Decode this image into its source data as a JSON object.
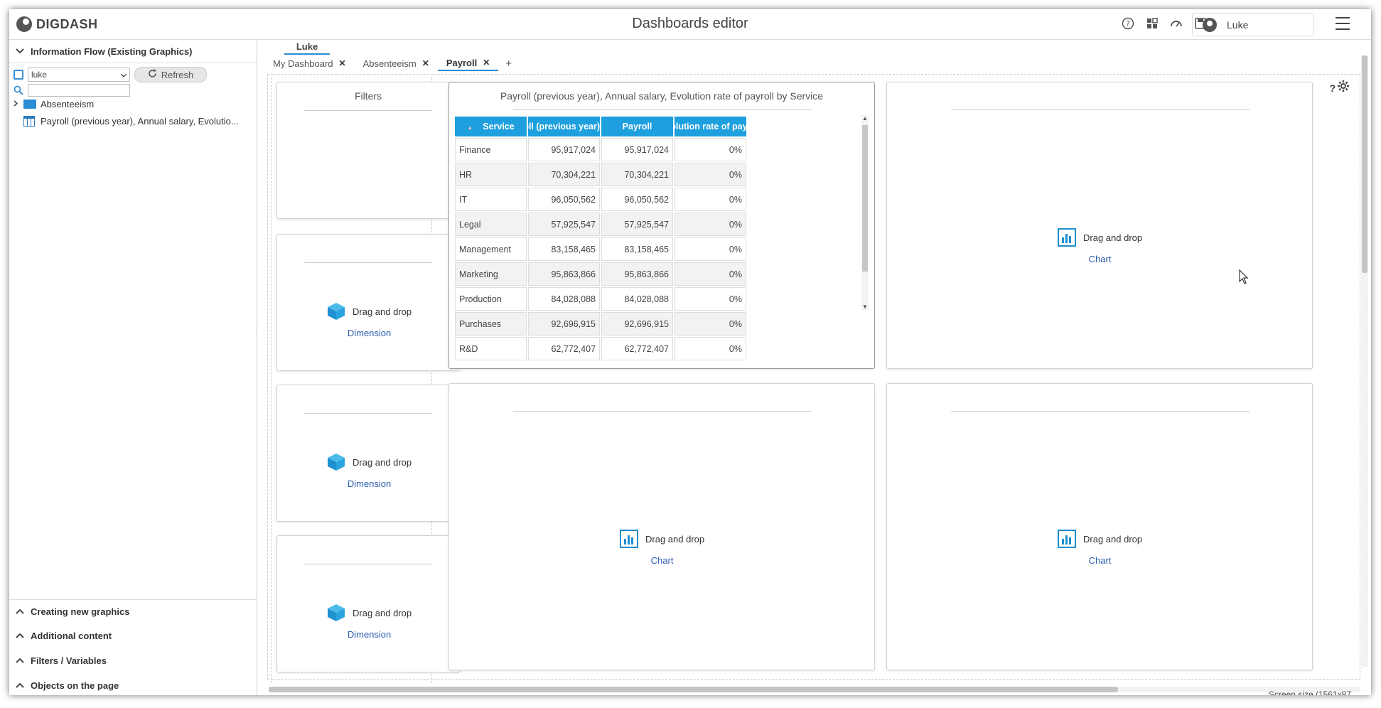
{
  "header": {
    "brand": "DIGDASH",
    "title": "Dashboards editor",
    "icons": [
      "help-icon",
      "widgets-icon",
      "gauge-icon",
      "save-icon"
    ],
    "user_name": "Luke"
  },
  "left_panel": {
    "info_flow_title": "Information Flow (Existing Graphics)",
    "flow_select_value": "luke",
    "refresh_label": "Refresh",
    "search_placeholder": "",
    "tree": [
      {
        "label": "Absenteeism",
        "type": "folder"
      },
      {
        "label": "Payroll (previous year), Annual salary, Evolutio...",
        "type": "table"
      }
    ],
    "bottom_sections": [
      "Creating new graphics",
      "Additional content",
      "Filters / Variables",
      "Objects on the page"
    ]
  },
  "main": {
    "tab_owner": "Luke",
    "tabs": [
      {
        "label": "My Dashboard",
        "active": false
      },
      {
        "label": "Absenteeism",
        "active": false
      },
      {
        "label": "Payroll",
        "active": true
      }
    ],
    "add_tab": "+",
    "filters_title": "Filters",
    "drag_drop_label": "Drag and drop",
    "dimension_label": "Dimension",
    "chart_label": "Chart",
    "help_mark": "?",
    "screen_size": "Screen size (1561x87",
    "table_card": {
      "title": "Payroll (previous year), Annual salary, Evolution rate of payroll by Service",
      "sort_mark": "▲",
      "columns": [
        "Service",
        "Payroll (previous year)",
        "Payroll",
        "Evolution rate of payroll"
      ],
      "rows": [
        [
          "Finance",
          "95,917,024",
          "95,917,024",
          "0%"
        ],
        [
          "HR",
          "70,304,221",
          "70,304,221",
          "0%"
        ],
        [
          "IT",
          "96,050,562",
          "96,050,562",
          "0%"
        ],
        [
          "Legal",
          "57,925,547",
          "57,925,547",
          "0%"
        ],
        [
          "Management",
          "83,158,465",
          "83,158,465",
          "0%"
        ],
        [
          "Marketing",
          "95,863,866",
          "95,863,866",
          "0%"
        ],
        [
          "Production",
          "84,028,088",
          "84,028,088",
          "0%"
        ],
        [
          "Purchases",
          "92,696,915",
          "92,696,915",
          "0%"
        ],
        [
          "R&D",
          "62,772,407",
          "62,772,407",
          "0%"
        ]
      ]
    }
  },
  "colors": {
    "accent": "#1e9fde",
    "link": "#2a5db0"
  }
}
